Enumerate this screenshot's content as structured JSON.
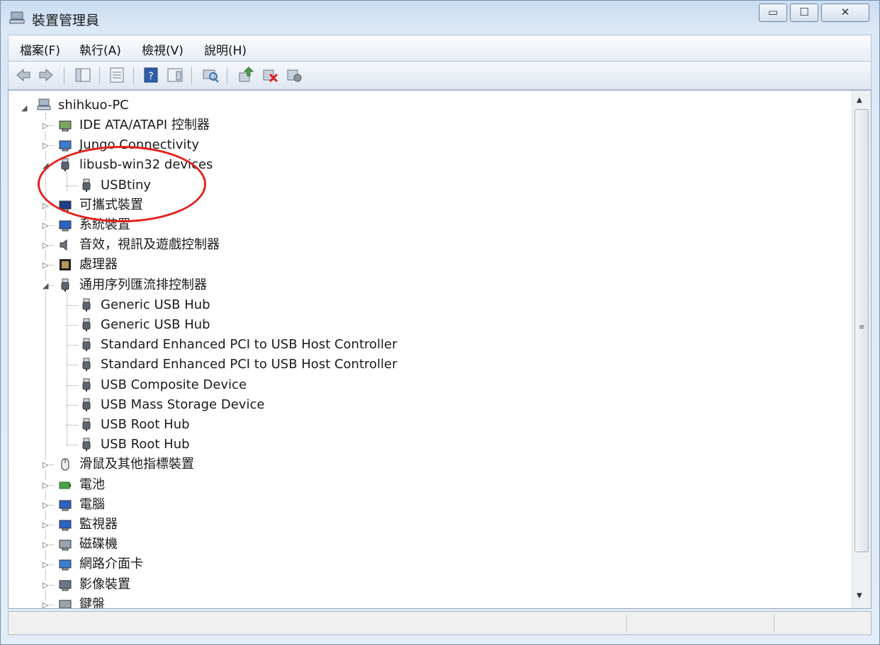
{
  "window": {
    "title": "裝置管理員",
    "controls": {
      "minimize": "▭",
      "maximize": "☐",
      "close": "✕"
    }
  },
  "menu": [
    {
      "label": "檔案(F)"
    },
    {
      "label": "執行(A)"
    },
    {
      "label": "檢視(V)"
    },
    {
      "label": "說明(H)"
    }
  ],
  "toolbar": {
    "icons": [
      "back-icon",
      "forward-icon",
      "show-hide-console-tree-icon",
      "properties-icon",
      "help-icon",
      "action-pane-icon",
      "scan-hardware-icon",
      "update-driver-icon",
      "uninstall-icon",
      "disable-device-icon"
    ]
  },
  "tree": {
    "root": "shihkuo-PC",
    "items": [
      {
        "label": "IDE ATA/ATAPI 控制器",
        "icon": "ide-controller-icon",
        "expanded": false
      },
      {
        "label": "Jungo Connectivity",
        "icon": "network-device-icon",
        "expanded": false
      },
      {
        "label": "libusb-win32 devices",
        "icon": "usb-plug-icon",
        "expanded": true
      },
      {
        "label": "USBtiny",
        "icon": "usb-plug-icon",
        "child": true
      },
      {
        "label": "可攜式裝置",
        "icon": "portable-device-icon",
        "expanded": false
      },
      {
        "label": "系統裝置",
        "icon": "computer-icon",
        "expanded": false
      },
      {
        "label": "音效，視訊及遊戲控制器",
        "icon": "speaker-icon",
        "expanded": false
      },
      {
        "label": "處理器",
        "icon": "processor-icon",
        "expanded": false
      },
      {
        "label": "通用序列匯流排控制器",
        "icon": "usb-plug-icon",
        "expanded": true
      },
      {
        "label": "Generic USB Hub",
        "icon": "usb-plug-icon",
        "child": true
      },
      {
        "label": "Generic USB Hub",
        "icon": "usb-plug-icon",
        "child": true
      },
      {
        "label": "Standard Enhanced PCI to USB Host Controller",
        "icon": "usb-plug-icon",
        "child": true
      },
      {
        "label": "Standard Enhanced PCI to USB Host Controller",
        "icon": "usb-plug-icon",
        "child": true
      },
      {
        "label": "USB Composite Device",
        "icon": "usb-plug-icon",
        "child": true
      },
      {
        "label": "USB Mass Storage Device",
        "icon": "usb-plug-icon",
        "child": true
      },
      {
        "label": "USB Root Hub",
        "icon": "usb-plug-icon",
        "child": true
      },
      {
        "label": "USB Root Hub",
        "icon": "usb-plug-icon",
        "child": true
      },
      {
        "label": "滑鼠及其他指標裝置",
        "icon": "mouse-icon",
        "expanded": false
      },
      {
        "label": "電池",
        "icon": "battery-icon",
        "expanded": false
      },
      {
        "label": "電腦",
        "icon": "computer-icon",
        "expanded": false
      },
      {
        "label": "監視器",
        "icon": "monitor-icon",
        "expanded": false
      },
      {
        "label": "磁碟機",
        "icon": "disk-drive-icon",
        "expanded": false
      },
      {
        "label": "網路介面卡",
        "icon": "network-adapter-icon",
        "expanded": false
      },
      {
        "label": "影像裝置",
        "icon": "imaging-device-icon",
        "expanded": false
      },
      {
        "label": "鍵盤",
        "icon": "keyboard-icon",
        "expanded": false
      }
    ]
  },
  "colors": {
    "highlight_ellipse": "#e2221d"
  }
}
